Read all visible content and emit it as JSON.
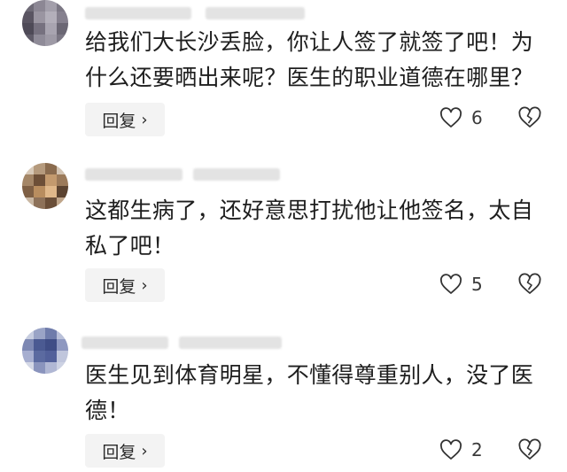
{
  "comments": [
    {
      "text": "给我们大长沙丢脸，你让人签了就签了吧！为什么还要晒出来呢？医生的职业道德在哪里？",
      "reply_label": "回复",
      "likes": "6",
      "avatar_colors": [
        "#6e6a76",
        "#8c8794",
        "#a39fab",
        "#7b7784",
        "#5a5562",
        "#9a95a1",
        "#b3afba",
        "#85808e",
        "#4e4a57",
        "#76717f",
        "#a8a4b0",
        "#6b6774",
        "#5f5b68",
        "#8f8b98",
        "#9e9aa6",
        "#7a7683"
      ]
    },
    {
      "text": "这都生病了，还好意思打扰他让他签名，太自私了吧！",
      "reply_label": "回复",
      "likes": "5",
      "avatar_colors": [
        "#d8c9b8",
        "#b59a7d",
        "#8a6b4e",
        "#d2c3b2",
        "#a48667",
        "#6d4f37",
        "#c39a6e",
        "#9b7a5a",
        "#7e5f44",
        "#b88d5f",
        "#e0b88a",
        "#5b4330",
        "#c9b7a3",
        "#8d7159",
        "#6a4e38",
        "#bfa58a"
      ]
    },
    {
      "text": "医生见到体育明星，不懂得尊重别人，没了医德！",
      "reply_label": "回复",
      "likes": "2",
      "avatar_colors": [
        "#c7cde0",
        "#9aa4c6",
        "#6f7cab",
        "#b9c0d9",
        "#7d88b3",
        "#4b5a92",
        "#3f4d86",
        "#8e98c0",
        "#a6aed0",
        "#5b6aa0",
        "#52609a",
        "#c0c6dc",
        "#d4d8e6",
        "#8a94bd",
        "#b0b7d4",
        "#cdd2e3"
      ]
    }
  ]
}
